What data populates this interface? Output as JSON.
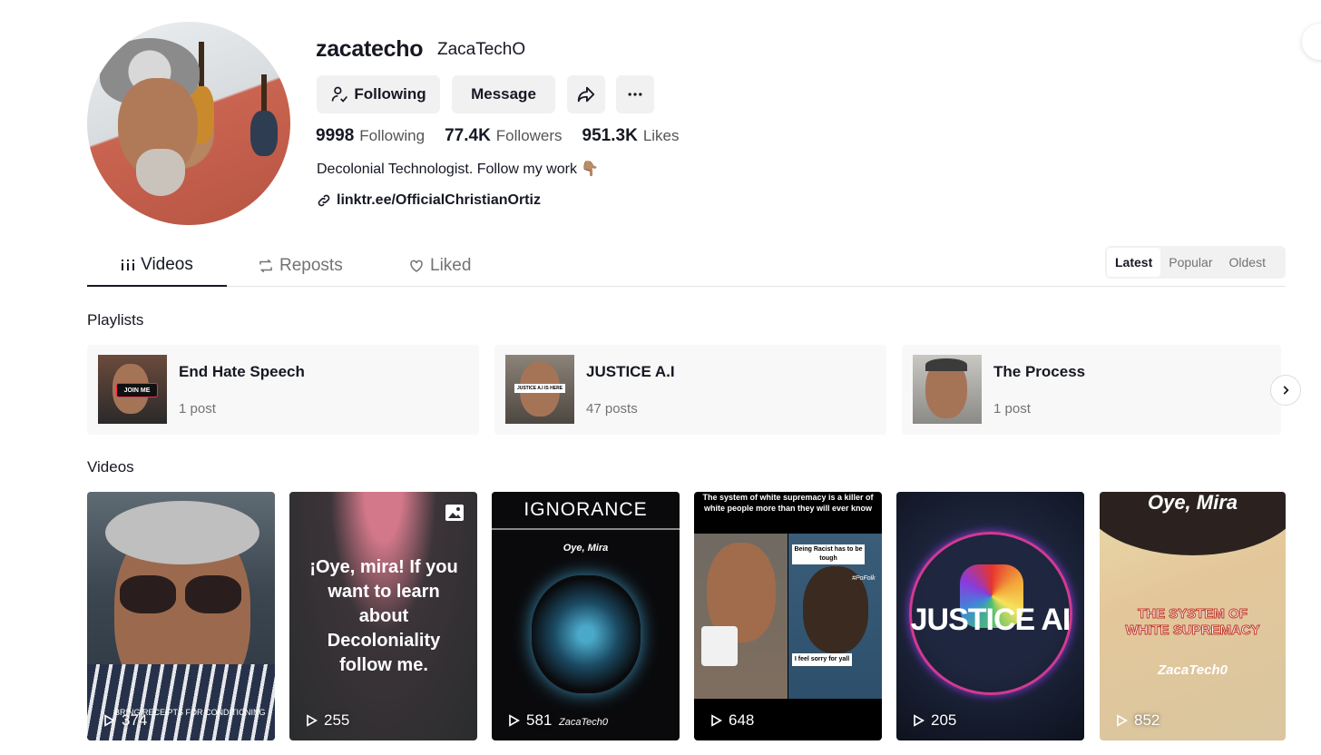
{
  "profile": {
    "username": "zacatecho",
    "nickname": "ZacaTechO",
    "bio": "Decolonial Technologist. Follow my work 👇🏽",
    "link": "linktr.ee/OfficialChristianOrtiz"
  },
  "actions": {
    "following_label": "Following",
    "message_label": "Message"
  },
  "stats": [
    {
      "value": "9998",
      "label": "Following"
    },
    {
      "value": "77.4K",
      "label": "Followers"
    },
    {
      "value": "951.3K",
      "label": "Likes"
    }
  ],
  "tabs": [
    {
      "label": "Videos",
      "icon": "grid-icon",
      "active": true
    },
    {
      "label": "Reposts",
      "icon": "repost-icon",
      "active": false
    },
    {
      "label": "Liked",
      "icon": "heart-lock-icon",
      "active": false
    }
  ],
  "sort": {
    "options": [
      "Latest",
      "Popular",
      "Oldest"
    ],
    "selected": "Latest"
  },
  "sections": {
    "playlists": "Playlists",
    "videos": "Videos"
  },
  "playlists": [
    {
      "name": "End Hate Speech",
      "count": "1 post",
      "thumb_text": "JOIN ME"
    },
    {
      "name": "JUSTICE A.I",
      "count": "47 posts",
      "thumb_text": "JUSTICE A.I IS HERE"
    },
    {
      "name": "The Process",
      "count": "1 post"
    }
  ],
  "videos": [
    {
      "views": "374",
      "overlay": "BRING RECEIPTS FOR CONDITIONING"
    },
    {
      "views": "255",
      "overlay": "¡Oye, mira! If you want to learn about Decoloniality follow me."
    },
    {
      "views": "581",
      "overlay": "IGNORANCE",
      "sub": "Oye, Mira",
      "sig": "ZacaTech0"
    },
    {
      "views": "648",
      "overlay": "The system of white supremacy is a killer of white people more than they will ever know",
      "bubble1": "Being Racist has to be tough",
      "bubble2": "I feel sorry for yall",
      "tag": "#PoFolk"
    },
    {
      "views": "205",
      "overlay": "JUSTICE AI"
    },
    {
      "views": "852",
      "overlay": "Oye, Mira",
      "sub": "THE SYSTEM OF WHITE SUPREMACY",
      "sig": "ZacaTech0"
    }
  ],
  "colors": {
    "primary_text": "#161823",
    "secondary_text": "#737373",
    "button_bg": "#f1f1f2"
  }
}
